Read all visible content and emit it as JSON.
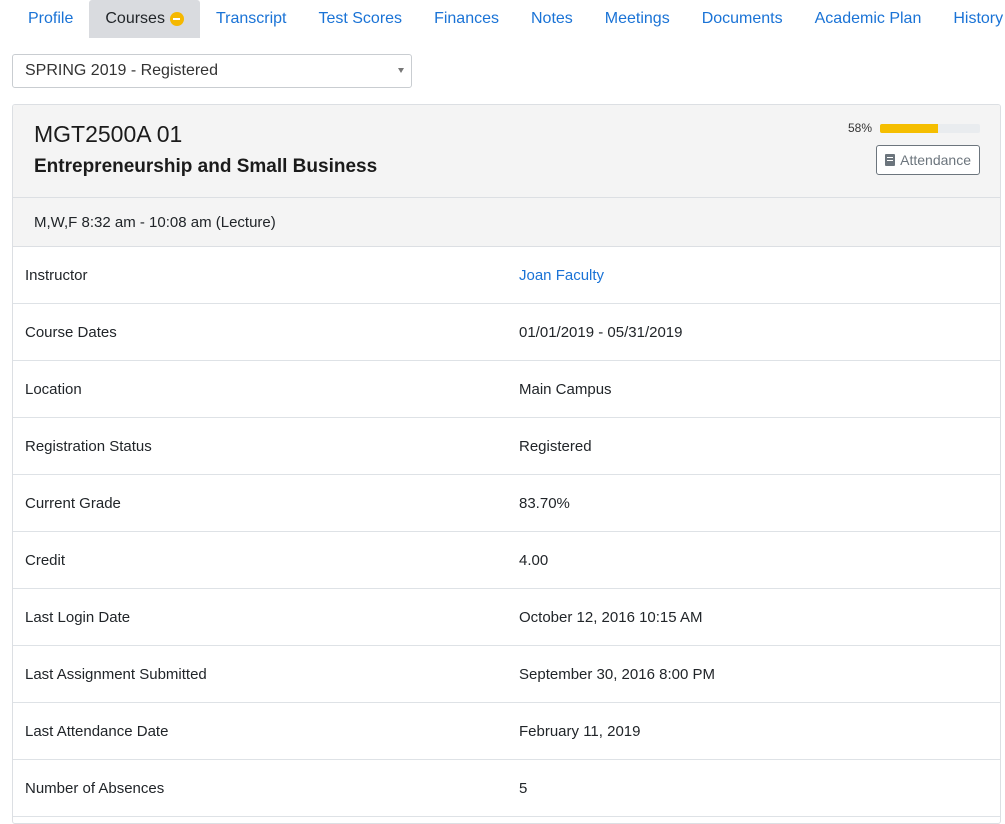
{
  "nav": {
    "tabs": [
      {
        "label": "Profile"
      },
      {
        "label": "Courses"
      },
      {
        "label": "Transcript"
      },
      {
        "label": "Test Scores"
      },
      {
        "label": "Finances"
      },
      {
        "label": "Notes"
      },
      {
        "label": "Meetings"
      },
      {
        "label": "Documents"
      },
      {
        "label": "Academic Plan"
      },
      {
        "label": "History"
      }
    ],
    "active_tab": "Courses",
    "courses_badge_icon": "minus-circle-icon",
    "badge_color": "#f5b800"
  },
  "term_select": {
    "value": "SPRING 2019 - Registered"
  },
  "course": {
    "code": "MGT2500A 01",
    "name": "Entrepreneurship and Small Business",
    "progress_label": "58%",
    "progress_value": 58,
    "progress_color": "#f5be00",
    "attendance_label": "Attendance",
    "attendance_icon": "book-icon",
    "schedule": "M,W,F 8:32 am - 10:08 am (Lecture)"
  },
  "details": [
    {
      "label": "Instructor",
      "value": "Joan Faculty"
    },
    {
      "label": "Course Dates",
      "value": "01/01/2019 - 05/31/2019"
    },
    {
      "label": "Location",
      "value": "Main Campus"
    },
    {
      "label": "Registration Status",
      "value": "Registered"
    },
    {
      "label": "Current Grade",
      "value": "83.70%"
    },
    {
      "label": "Credit",
      "value": "4.00"
    },
    {
      "label": "Last Login Date",
      "value": "October 12, 2016 10:15 AM"
    },
    {
      "label": "Last Assignment Submitted",
      "value": "September 30, 2016 8:00 PM"
    },
    {
      "label": "Last Attendance Date",
      "value": "February 11, 2019"
    },
    {
      "label": "Number of Absences",
      "value": "5"
    }
  ]
}
